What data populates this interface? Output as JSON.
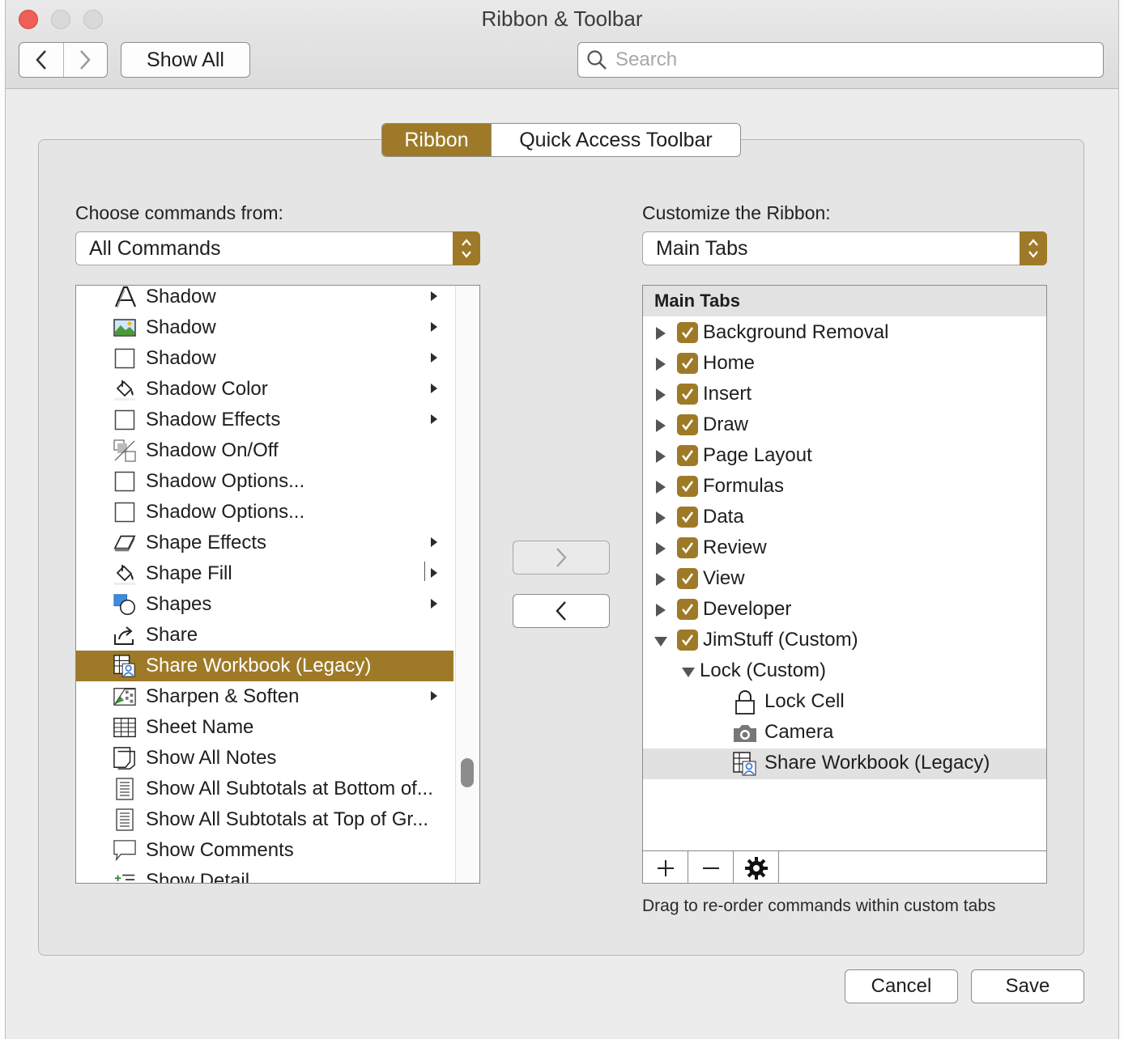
{
  "window": {
    "title": "Ribbon & Toolbar"
  },
  "toolbar": {
    "show_all": "Show All",
    "search_placeholder": "Search"
  },
  "tabs": {
    "ribbon": "Ribbon",
    "quick_access": "Quick Access Toolbar"
  },
  "left": {
    "label": "Choose commands from:",
    "selected": "All Commands",
    "commands": [
      {
        "label": "Shadow",
        "icon": "text-shadow-icon",
        "submenu": true
      },
      {
        "label": "Shadow",
        "icon": "picture-shadow-icon",
        "submenu": true
      },
      {
        "label": "Shadow",
        "icon": "blank-square-icon",
        "submenu": true
      },
      {
        "label": "Shadow Color",
        "icon": "paint-bucket-icon",
        "submenu": true
      },
      {
        "label": "Shadow Effects",
        "icon": "blank-square-icon",
        "submenu": true
      },
      {
        "label": "Shadow On/Off",
        "icon": "shadow-toggle-icon",
        "submenu": false
      },
      {
        "label": "Shadow Options...",
        "icon": "blank-square-icon",
        "submenu": false
      },
      {
        "label": "Shadow Options...",
        "icon": "blank-square-icon",
        "submenu": false
      },
      {
        "label": "Shape Effects",
        "icon": "shape-effects-icon",
        "submenu": true
      },
      {
        "label": "Shape Fill",
        "icon": "paint-bucket-icon",
        "submenu": true
      },
      {
        "label": "Shapes",
        "icon": "shapes-icon",
        "submenu": true
      },
      {
        "label": "Share",
        "icon": "share-icon",
        "submenu": false
      },
      {
        "label": "Share Workbook (Legacy)",
        "icon": "share-workbook-icon",
        "submenu": false,
        "selected": true
      },
      {
        "label": "Sharpen & Soften",
        "icon": "sharpen-icon",
        "submenu": true
      },
      {
        "label": "Sheet Name",
        "icon": "sheet-grid-icon",
        "submenu": false
      },
      {
        "label": "Show All Notes",
        "icon": "notes-icon",
        "submenu": false
      },
      {
        "label": "Show All Subtotals at Bottom of...",
        "icon": "subtotals-icon",
        "submenu": false
      },
      {
        "label": "Show All Subtotals at Top of Gr...",
        "icon": "subtotals-icon",
        "submenu": false
      },
      {
        "label": "Show Comments",
        "icon": "comment-icon",
        "submenu": false
      },
      {
        "label": "Show Detail",
        "icon": "show-detail-icon",
        "submenu": false
      }
    ]
  },
  "right": {
    "label": "Customize the Ribbon:",
    "selected": "Main Tabs",
    "tree_header": "Main Tabs",
    "tabs": [
      "Background Removal",
      "Home",
      "Insert",
      "Draw",
      "Page Layout",
      "Formulas",
      "Data",
      "Review",
      "View",
      "Developer",
      "JimStuff (Custom)"
    ],
    "group": "Lock (Custom)",
    "group_commands": [
      {
        "label": "Lock Cell",
        "icon": "lock-icon"
      },
      {
        "label": "Camera",
        "icon": "camera-icon"
      },
      {
        "label": "Share Workbook (Legacy)",
        "icon": "share-workbook-icon",
        "highlighted": true
      }
    ],
    "hint": "Drag to re-order commands within custom tabs"
  },
  "buttons": {
    "cancel": "Cancel",
    "save": "Save"
  },
  "colors": {
    "accent": "#9e7a28",
    "close": "#ed5f57"
  }
}
